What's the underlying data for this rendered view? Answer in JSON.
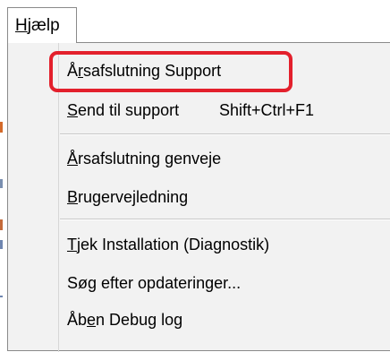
{
  "menubar": {
    "help_menu": {
      "prefix": "",
      "underline": "H",
      "suffix": "jælp"
    }
  },
  "menu": {
    "items": [
      {
        "prefix": "Å",
        "underline": "r",
        "suffix": "safslutning Support",
        "shortcut": ""
      },
      {
        "prefix": "",
        "underline": "S",
        "suffix": "end til support",
        "shortcut": "Shift+Ctrl+F1"
      },
      {
        "prefix": "",
        "underline": "Å",
        "suffix": "rsafslutning genveje",
        "shortcut": ""
      },
      {
        "prefix": "",
        "underline": "B",
        "suffix": "rugervejledning",
        "shortcut": ""
      },
      {
        "prefix": "",
        "underline": "T",
        "suffix": "jek Installation (Diagnostik)",
        "shortcut": ""
      },
      {
        "prefix": "Sø",
        "underline": "g",
        "suffix": " efter opdateringer...",
        "shortcut": ""
      },
      {
        "prefix": "Åb",
        "underline": "e",
        "suffix": "n Debug log",
        "shortcut": ""
      }
    ]
  },
  "annotation": {
    "highlight_color": "#e3202c",
    "highlighted_item": "Årsafslutning Support"
  }
}
